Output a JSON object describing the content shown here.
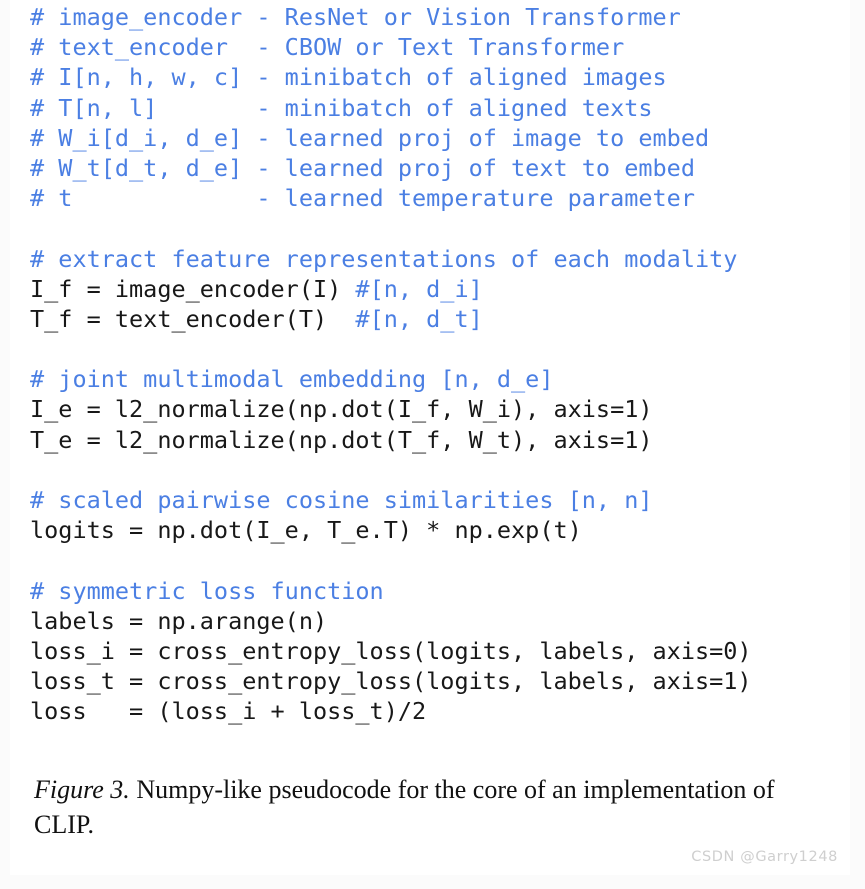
{
  "figure": {
    "kind": "paper-figure-pseudocode",
    "colors": {
      "comment_blue": "#4b7fe3",
      "code_black": "#181818",
      "page_background": "#fbfbfb",
      "paper_background": "#ffffff",
      "watermark_grey": "#cfcfcf"
    }
  },
  "code": {
    "language": "numpy-pseudocode",
    "lines": [
      {
        "id": "l01",
        "type": "comment",
        "text": "# image_encoder - ResNet or Vision Transformer"
      },
      {
        "id": "l02",
        "type": "comment",
        "text": "# text_encoder  - CBOW or Text Transformer"
      },
      {
        "id": "l03",
        "type": "comment",
        "text": "# I[n, h, w, c] - minibatch of aligned images"
      },
      {
        "id": "l04",
        "type": "comment",
        "text": "# T[n, l]       - minibatch of aligned texts"
      },
      {
        "id": "l05",
        "type": "comment",
        "text": "# W_i[d_i, d_e] - learned proj of image to embed"
      },
      {
        "id": "l06",
        "type": "comment",
        "text": "# W_t[d_t, d_e] - learned proj of text to embed"
      },
      {
        "id": "l07",
        "type": "comment",
        "text": "# t             - learned temperature parameter"
      },
      {
        "id": "l08",
        "type": "blank",
        "text": ""
      },
      {
        "id": "l09",
        "type": "comment",
        "text": "# extract feature representations of each modality"
      },
      {
        "id": "l10",
        "type": "mixed",
        "code": "I_f = image_encoder(I) ",
        "comment": "#[n, d_i]"
      },
      {
        "id": "l11",
        "type": "mixed",
        "code": "T_f = text_encoder(T)  ",
        "comment": "#[n, d_t]"
      },
      {
        "id": "l12",
        "type": "blank",
        "text": ""
      },
      {
        "id": "l13",
        "type": "comment",
        "text": "# joint multimodal embedding [n, d_e]"
      },
      {
        "id": "l14",
        "type": "code",
        "text": "I_e = l2_normalize(np.dot(I_f, W_i), axis=1)"
      },
      {
        "id": "l15",
        "type": "code",
        "text": "T_e = l2_normalize(np.dot(T_f, W_t), axis=1)"
      },
      {
        "id": "l16",
        "type": "blank",
        "text": ""
      },
      {
        "id": "l17",
        "type": "comment",
        "text": "# scaled pairwise cosine similarities [n, n]"
      },
      {
        "id": "l18",
        "type": "code",
        "text": "logits = np.dot(I_e, T_e.T) * np.exp(t)"
      },
      {
        "id": "l19",
        "type": "blank",
        "text": ""
      },
      {
        "id": "l20",
        "type": "comment",
        "text": "# symmetric loss function"
      },
      {
        "id": "l21",
        "type": "code",
        "text": "labels = np.arange(n)"
      },
      {
        "id": "l22",
        "type": "code",
        "text": "loss_i = cross_entropy_loss(logits, labels, axis=0)"
      },
      {
        "id": "l23",
        "type": "code",
        "text": "loss_t = cross_entropy_loss(logits, labels, axis=1)"
      },
      {
        "id": "l24",
        "type": "code",
        "text": "loss   = (loss_i + loss_t)/2"
      }
    ]
  },
  "caption": {
    "label": "Figure 3.",
    "text": " Numpy-like pseudocode for the core of an implementation of CLIP."
  },
  "watermark": {
    "text": "CSDN @Garry1248"
  }
}
